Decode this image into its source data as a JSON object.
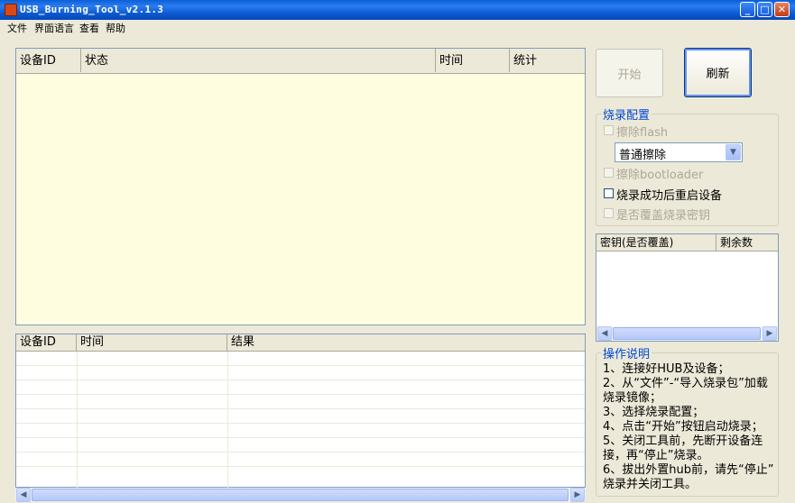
{
  "window": {
    "title": "USB_Burning_Tool_v2.1.3",
    "controls": {
      "minimize": "_",
      "maximize": "□",
      "close": "✕"
    }
  },
  "menu": [
    "文件",
    "界面语言",
    "查看",
    "帮助"
  ],
  "device_table": {
    "columns": [
      "设备ID",
      "状态",
      "时间",
      "统计"
    ],
    "background": "#fffde0"
  },
  "result_table": {
    "columns": [
      "设备ID",
      "时间",
      "结果"
    ]
  },
  "buttons": {
    "start": "开始",
    "refresh": "刷新"
  },
  "burn_config": {
    "title": "烧录配置",
    "erase_flash": "擦除flash",
    "erase_mode_selected": "普通擦除",
    "erase_bootloader": "擦除bootloader",
    "reboot_after_success": "烧录成功后重启设备",
    "overwrite_key": "是否覆盖烧录密钥"
  },
  "key_table": {
    "columns": [
      "密钥(是否覆盖)",
      "剩余数"
    ]
  },
  "instructions": {
    "title": "操作说明",
    "lines": [
      "1、连接好HUB及设备；",
      "2、从“文件”-“导入烧录包”加载",
      "烧录镜像；",
      "3、选择烧录配置；",
      "4、点击“开始”按钮启动烧录；",
      "5、关闭工具前，先断开设备连",
      "接，再“停止”烧录。",
      "6、拔出外置hub前，请先“停止”",
      "烧录并关闭工具。"
    ]
  },
  "colors": {
    "titlebar": "#0a58d0",
    "window_bg": "#ece9d8",
    "group_title": "#0046d5"
  }
}
